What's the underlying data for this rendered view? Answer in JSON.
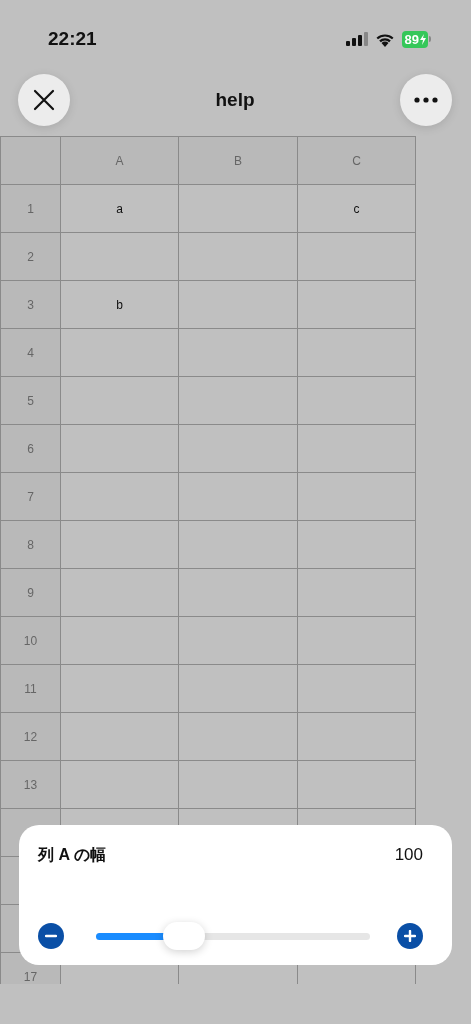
{
  "status_bar": {
    "time": "22:21",
    "battery": "89"
  },
  "nav": {
    "title": "help"
  },
  "table": {
    "columns": [
      "A",
      "B",
      "C"
    ],
    "rows": [
      {
        "label": "1",
        "cells": [
          "a",
          null,
          "c"
        ]
      },
      {
        "label": "2"
      },
      {
        "label": "3",
        "cells": [
          "b",
          null,
          null
        ]
      },
      {
        "label": "4"
      },
      {
        "label": "5"
      },
      {
        "label": "6"
      },
      {
        "label": "7"
      },
      {
        "label": "8"
      },
      {
        "label": "9"
      },
      {
        "label": "10"
      },
      {
        "label": "11"
      },
      {
        "label": "12"
      },
      {
        "label": "13"
      },
      {},
      {},
      {},
      {
        "label": "17"
      }
    ]
  },
  "width_panel": {
    "title": "列 A の幅",
    "value": "100",
    "level": 0.32
  }
}
